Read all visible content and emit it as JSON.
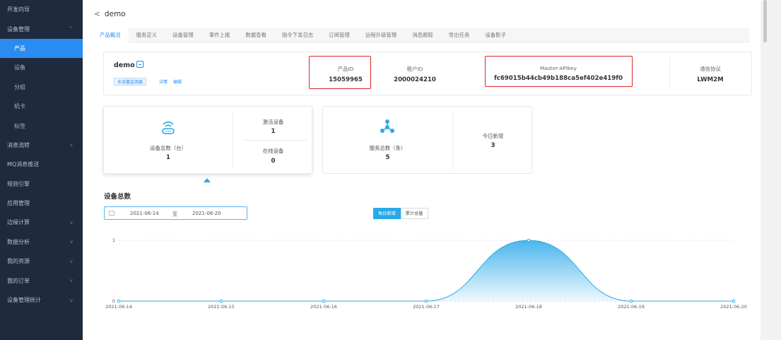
{
  "sidebar": {
    "items": [
      {
        "label": "开发向导",
        "child": false,
        "active": false,
        "chevron": false
      },
      {
        "label": "设备管理",
        "child": false,
        "active": false,
        "chevron": "up"
      },
      {
        "label": "产品",
        "child": true,
        "active": true,
        "chevron": false
      },
      {
        "label": "设备",
        "child": true,
        "active": false,
        "chevron": false
      },
      {
        "label": "分组",
        "child": true,
        "active": false,
        "chevron": false
      },
      {
        "label": "机卡",
        "child": true,
        "active": false,
        "chevron": false
      },
      {
        "label": "标签",
        "child": true,
        "active": false,
        "chevron": false
      },
      {
        "label": "消息流转",
        "child": false,
        "active": false,
        "chevron": "down"
      },
      {
        "label": "MQ消息推送",
        "child": false,
        "active": false,
        "chevron": false
      },
      {
        "label": "规则引擎",
        "child": false,
        "active": false,
        "chevron": false
      },
      {
        "label": "应用管理",
        "child": false,
        "active": false,
        "chevron": false
      },
      {
        "label": "边缘计算",
        "child": false,
        "active": false,
        "chevron": "down"
      },
      {
        "label": "数据分析",
        "child": false,
        "active": false,
        "chevron": "down"
      },
      {
        "label": "我的资源",
        "child": false,
        "active": false,
        "chevron": "down"
      },
      {
        "label": "我的订单",
        "child": false,
        "active": false,
        "chevron": "down"
      },
      {
        "label": "设备管理统计",
        "child": false,
        "active": false,
        "chevron": "down"
      }
    ]
  },
  "header": {
    "back_glyph": "<",
    "title": "demo"
  },
  "tabs": [
    "产品概况",
    "服务定义",
    "设备管理",
    "事件上报",
    "数据查看",
    "指令下发日志",
    "订阅管理",
    "远程升级管理",
    "消息跟踪",
    "导出任务",
    "设备影子"
  ],
  "active_tab": 0,
  "product": {
    "name": "demo",
    "tag": "水流量监测器",
    "link_detail": "详情",
    "link_edit": "编辑",
    "fields": [
      {
        "label": "产品ID",
        "value": "15059965"
      },
      {
        "label": "租户ID",
        "value": "2000024210"
      },
      {
        "label": "Master-APIkey",
        "value": "fc69015b44cb49b188ca5ef402e419f0"
      },
      {
        "label": "通信协议",
        "value": "LWM2M"
      }
    ]
  },
  "device_card": {
    "total_label": "设备总数（台）",
    "total_value": "1",
    "active_label": "激活设备",
    "active_value": "1",
    "online_label": "在线设备",
    "online_value": "0"
  },
  "service_card": {
    "total_label": "服务总数（条）",
    "total_value": "5",
    "new_label": "今日新增",
    "new_value": "3"
  },
  "section_title": "设备总数",
  "date_range": {
    "start": "2021-06-14",
    "sep": "至",
    "end": "2021-06-20"
  },
  "toggle": {
    "daily": "每日新增",
    "cumulative": "累计总量"
  },
  "colors": {
    "accent": "#2a8cf0",
    "chart": "#2aa9e8",
    "sidebar": "#1f2a3e",
    "highlight_box": "#e02424"
  },
  "chart_data": {
    "type": "area",
    "x": [
      "2021-06-14",
      "2021-06-15",
      "2021-06-16",
      "2021-06-17",
      "2021-06-18",
      "2021-06-19",
      "2021-06-20"
    ],
    "values": [
      0,
      0,
      0,
      0,
      1,
      0,
      0
    ],
    "yticks": [
      "0",
      "1"
    ],
    "ylim": [
      0,
      1
    ],
    "grid": true,
    "smooth": true
  }
}
